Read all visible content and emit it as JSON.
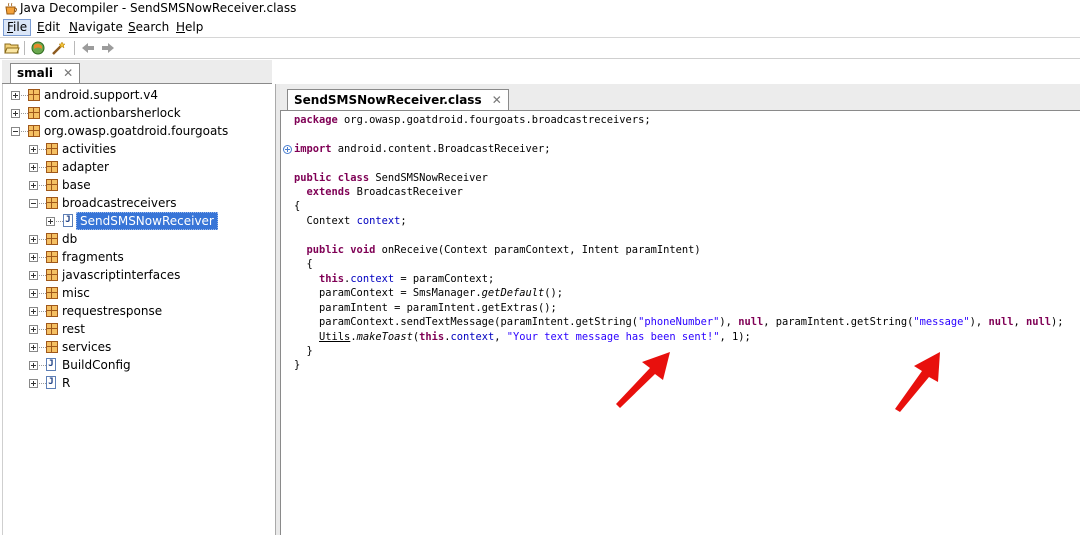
{
  "window": {
    "title": "Java Decompiler - SendSMSNowReceiver.class",
    "app_icon": "coffee-cup-icon"
  },
  "menu": {
    "items": [
      {
        "label": "File",
        "mnemonic": "F",
        "rest": "ile"
      },
      {
        "label": "Edit",
        "mnemonic": "E",
        "rest": "dit"
      },
      {
        "label": "Navigate",
        "mnemonic": "N",
        "rest": "avigate"
      },
      {
        "label": "Search",
        "mnemonic": "S",
        "rest": "earch"
      },
      {
        "label": "Help",
        "mnemonic": "H",
        "rest": "elp"
      }
    ]
  },
  "toolbar": {
    "icons": [
      "open-folder-icon",
      "open-type-icon",
      "wand-icon",
      "back-arrow-icon",
      "forward-arrow-icon"
    ]
  },
  "left_tab": {
    "label": "smali",
    "close": "✕"
  },
  "tree": {
    "items": [
      {
        "label": "android.support.v4"
      },
      {
        "label": "com.actionbarsherlock"
      },
      {
        "label": "org.owasp.goatdroid.fourgoats"
      },
      {
        "label": "activities"
      },
      {
        "label": "adapter"
      },
      {
        "label": "base"
      },
      {
        "label": "broadcastreceivers"
      },
      {
        "label": "SendSMSNowReceiver",
        "selected": true
      },
      {
        "label": "db"
      },
      {
        "label": "fragments"
      },
      {
        "label": "javascriptinterfaces"
      },
      {
        "label": "misc"
      },
      {
        "label": "requestresponse"
      },
      {
        "label": "rest"
      },
      {
        "label": "services"
      },
      {
        "label": "BuildConfig"
      },
      {
        "label": "R"
      }
    ]
  },
  "editor_tab": {
    "label": "SendSMSNowReceiver.class",
    "close": "✕"
  },
  "code": {
    "package_kw": "package",
    "package_name": " org.owasp.goatdroid.fourgoats.broadcastreceivers;",
    "import_kw": "import",
    "import_name": " android.content.BroadcastReceiver;",
    "class_kw": "public class",
    "class_name": " SendSMSNowReceiver",
    "extends_kw": "  extends",
    "extends_name": " BroadcastReceiver",
    "open_brace": "{",
    "field_type": "  Context ",
    "field_name": "context",
    "field_end": ";",
    "method_kw": "  public void",
    "method_sig": " onReceive(Context paramContext, Intent paramIntent)",
    "method_open": "  {",
    "l1_kw": "    this",
    "l1_dot": ".",
    "l1_field": "context",
    "l1_rest": " = paramContext;",
    "l2_a": "    paramContext = SmsManager.",
    "l2_b": "getDefault",
    "l2_c": "();",
    "l3": "    paramIntent = paramIntent.getExtras();",
    "l4_a": "    paramContext.sendTextMessage(paramIntent.getString(",
    "l4_s1": "\"phoneNumber\"",
    "l4_b": "), ",
    "l4_n1": "null",
    "l4_c": ", paramIntent.getString(",
    "l4_s2": "\"message\"",
    "l4_d": "), ",
    "l4_n2": "null",
    "l4_e": ", ",
    "l4_n3": "null",
    "l4_f": ");",
    "l5_pre": "    ",
    "l5_cls": "Utils",
    "l5_a": ".",
    "l5_m": "makeToast",
    "l5_b": "(",
    "l5_this": "this",
    "l5_c": ".",
    "l5_field": "context",
    "l5_d": ", ",
    "l5_str": "\"Your text message has been sent!\"",
    "l5_e": ", 1);",
    "method_close": "  }",
    "class_close": "}"
  },
  "colors": {
    "keyword": "#7f0055",
    "string": "#2a00ff",
    "field": "#0000c0",
    "selection": "#3875d7",
    "annotation_arrow": "#e8100d"
  },
  "annotations": {
    "arrow_icon": "red-arrow-icon"
  }
}
